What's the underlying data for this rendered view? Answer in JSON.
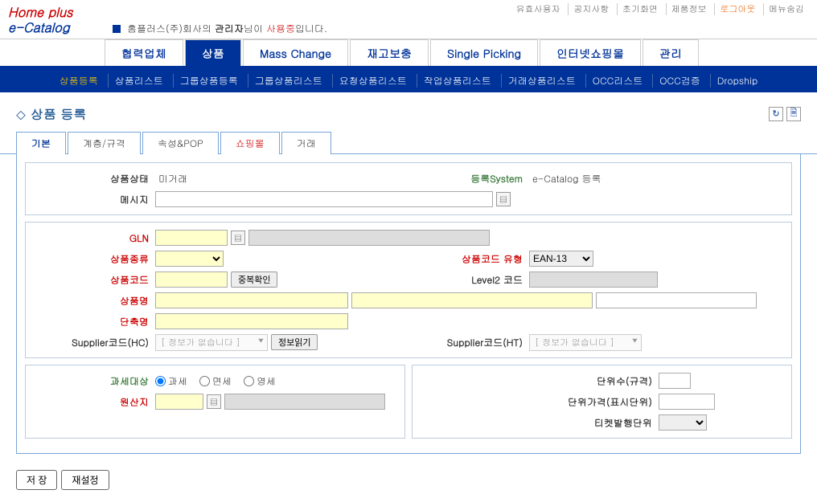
{
  "logo": {
    "line1": "Home plus",
    "line2": "e-Catalog"
  },
  "company_line": {
    "prefix": "홈플러스(주)회사의 ",
    "admin": "관리자",
    "mid": "님이 ",
    "status": "사용중",
    "suffix": "입니다."
  },
  "top_links": [
    "유효사용자",
    "공지사항",
    "초기화면",
    "제품정보",
    "로그아웃",
    "메뉴숨김"
  ],
  "main_nav": [
    "협력업체",
    "상품",
    "Mass Change",
    "재고보충",
    "Single Picking",
    "인터넷쇼핑몰",
    "관리"
  ],
  "main_nav_active": 1,
  "sub_nav": [
    "상품등록",
    "상품리스트",
    "그룹상품등록",
    "그룹상품리스트",
    "요청상품리스트",
    "작업상품리스트",
    "거래상품리스트",
    "OCC리스트",
    "OCC검증",
    "Dropship"
  ],
  "sub_nav_active": 0,
  "page_title": "상품 등록",
  "tabs": [
    "기본",
    "계층/규격",
    "속성&POP",
    "쇼핑몰",
    "거래"
  ],
  "tabs_active": 0,
  "section1": {
    "status_label": "상품상태",
    "status_value": "미거래",
    "system_label": "등록System",
    "system_value": "e-Catalog 등록",
    "message_label": "메시지"
  },
  "section2": {
    "gln_label": "GLN",
    "type_label": "상품종류",
    "code_type_label": "상품코드 유형",
    "code_type_value": "EAN-13",
    "code_label": "상품코드",
    "dup_btn": "중복확인",
    "level2_label": "Level2 코드",
    "name_label": "상품명",
    "short_label": "단축명",
    "supplier_hc_label": "Supplier코드(HC)",
    "supplier_ht_label": "Supplier코드(HT)",
    "no_info": "[ 정보가 없습니다 ]",
    "info_btn": "정보읽기"
  },
  "section3": {
    "tax_label": "과세대상",
    "tax_options": [
      "과세",
      "면세",
      "영세"
    ],
    "origin_label": "원산지"
  },
  "section4": {
    "unit_count_label": "단위수(규격)",
    "unit_price_label": "단위가격(표시단위)",
    "ticket_label": "티켓발행단위"
  },
  "buttons": {
    "save": "저 장",
    "reset": "재설정"
  }
}
